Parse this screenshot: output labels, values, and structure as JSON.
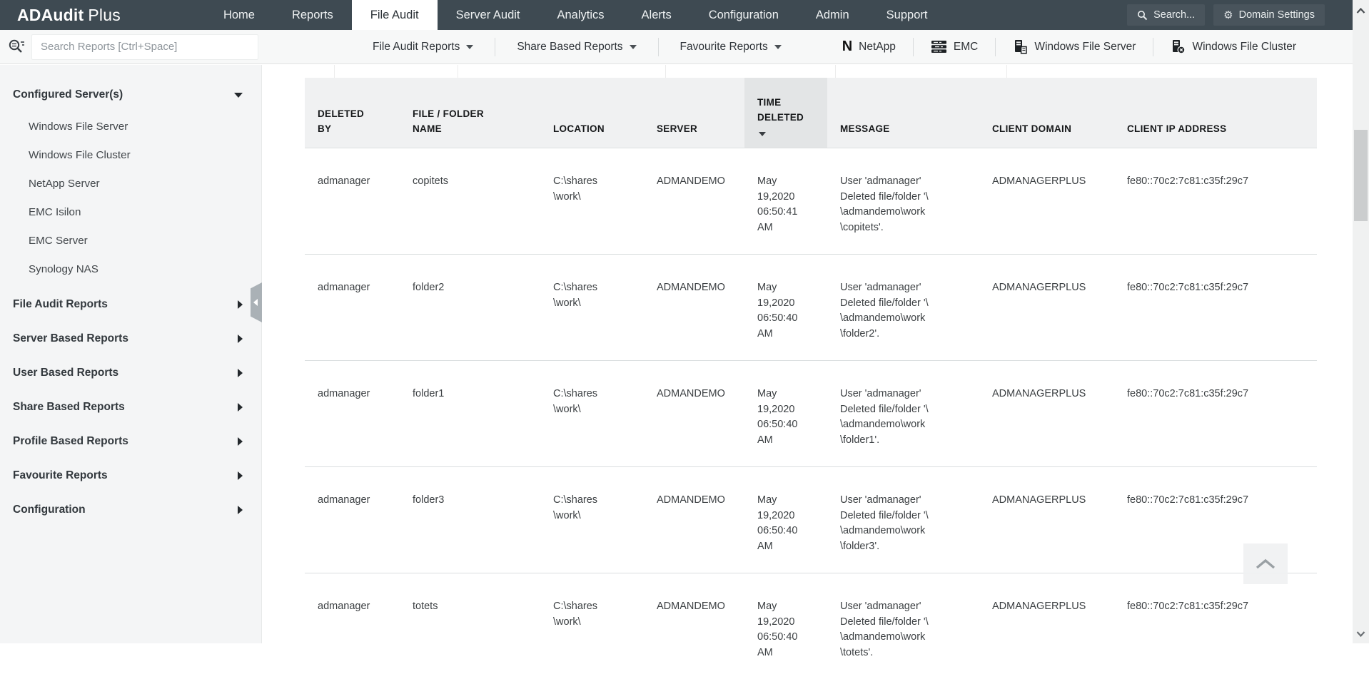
{
  "nav": {
    "brand_bold": "ADAudit",
    "brand_light": "Plus",
    "items": [
      {
        "label": "Home",
        "active": false
      },
      {
        "label": "Reports",
        "active": false
      },
      {
        "label": "File Audit",
        "active": true
      },
      {
        "label": "Server Audit",
        "active": false
      },
      {
        "label": "Analytics",
        "active": false
      },
      {
        "label": "Alerts",
        "active": false
      },
      {
        "label": "Configuration",
        "active": false
      },
      {
        "label": "Admin",
        "active": false
      },
      {
        "label": "Support",
        "active": false
      }
    ],
    "search_button_label": "Search...",
    "domain_settings_label": "Domain Settings"
  },
  "toolbar": {
    "search_placeholder": "Search Reports [Ctrl+Space]",
    "menus": [
      {
        "label": "File Audit Reports"
      },
      {
        "label": "Share Based Reports"
      },
      {
        "label": "Favourite Reports"
      }
    ],
    "server_shortcuts": [
      {
        "icon": "netapp-icon",
        "label": "NetApp"
      },
      {
        "icon": "emc-icon",
        "label": "EMC"
      },
      {
        "icon": "windows-file-server-icon",
        "label": "Windows File Server"
      },
      {
        "icon": "windows-file-cluster-icon",
        "label": "Windows File Cluster"
      }
    ]
  },
  "sidebar": {
    "sections": [
      {
        "label": "Configured Server(s)",
        "state": "expanded",
        "children": [
          "Windows File Server",
          "Windows File Cluster",
          "NetApp Server",
          "EMC Isilon",
          "EMC Server",
          "Synology NAS"
        ]
      },
      {
        "label": "File Audit Reports",
        "state": "collapsed",
        "children": []
      },
      {
        "label": "Server Based Reports",
        "state": "collapsed",
        "children": []
      },
      {
        "label": "User Based Reports",
        "state": "collapsed",
        "children": []
      },
      {
        "label": "Share Based Reports",
        "state": "collapsed",
        "children": []
      },
      {
        "label": "Profile Based Reports",
        "state": "collapsed",
        "children": []
      },
      {
        "label": "Favourite Reports",
        "state": "collapsed",
        "children": []
      },
      {
        "label": "Configuration",
        "state": "collapsed",
        "children": []
      }
    ]
  },
  "table": {
    "columns": [
      {
        "key": "deleted_by",
        "label": "DELETED\nBY",
        "sorted": false
      },
      {
        "key": "file_folder_name",
        "label": "FILE / FOLDER\nNAME",
        "sorted": false
      },
      {
        "key": "location",
        "label": "LOCATION",
        "sorted": false
      },
      {
        "key": "server",
        "label": "SERVER",
        "sorted": false
      },
      {
        "key": "time_deleted",
        "label": "TIME\nDELETED",
        "sorted": true,
        "sort_direction": "desc"
      },
      {
        "key": "message",
        "label": "MESSAGE",
        "sorted": false
      },
      {
        "key": "client_domain",
        "label": "CLIENT DOMAIN",
        "sorted": false
      },
      {
        "key": "client_ip_address",
        "label": "CLIENT IP ADDRESS",
        "sorted": false
      }
    ],
    "rows": [
      {
        "deleted_by": "admanager",
        "file_folder_name": "copitets",
        "location": "C:\\shares\\work\\",
        "server": "ADMANDEMO",
        "time_deleted": "May 19,2020 06:50:41 AM",
        "message": "User 'admanager' Deleted file/folder '\\\\admandemo\\work\\copitets'.",
        "client_domain": "ADMANAGERPLUS",
        "client_ip_address": "fe80::70c2:7c81:c35f:29c7"
      },
      {
        "deleted_by": "admanager",
        "file_folder_name": "folder2",
        "location": "C:\\shares\\work\\",
        "server": "ADMANDEMO",
        "time_deleted": "May 19,2020 06:50:40 AM",
        "message": "User 'admanager' Deleted file/folder '\\\\admandemo\\work\\folder2'.",
        "client_domain": "ADMANAGERPLUS",
        "client_ip_address": "fe80::70c2:7c81:c35f:29c7"
      },
      {
        "deleted_by": "admanager",
        "file_folder_name": "folder1",
        "location": "C:\\shares\\work\\",
        "server": "ADMANDEMO",
        "time_deleted": "May 19,2020 06:50:40 AM",
        "message": "User 'admanager' Deleted file/folder '\\\\admandemo\\work\\folder1'.",
        "client_domain": "ADMANAGERPLUS",
        "client_ip_address": "fe80::70c2:7c81:c35f:29c7"
      },
      {
        "deleted_by": "admanager",
        "file_folder_name": "folder3",
        "location": "C:\\shares\\work\\",
        "server": "ADMANDEMO",
        "time_deleted": "May 19,2020 06:50:40 AM",
        "message": "User 'admanager' Deleted file/folder '\\\\admandemo\\work\\folder3'.",
        "client_domain": "ADMANAGERPLUS",
        "client_ip_address": "fe80::70c2:7c81:c35f:29c7"
      },
      {
        "deleted_by": "admanager",
        "file_folder_name": "totets",
        "location": "C:\\shares\\work\\",
        "server": "ADMANDEMO",
        "time_deleted": "May 19,2020 06:50:40 AM",
        "message": "User 'admanager' Deleted file/folder '\\\\admandemo\\work\\totets'.",
        "client_domain": "ADMANAGERPLUS",
        "client_ip_address": "fe80::70c2:7c81:c35f:29c7"
      }
    ]
  },
  "colors": {
    "navbar_bg": "#3e4a52",
    "nav_button_bg": "#49545c",
    "active_tab_bg": "#ffffff",
    "toolbar_bg": "#f7f8f8",
    "sidebar_bg": "#f4f5f6",
    "table_header_bg": "#f0f1f2",
    "table_header_sorted_bg": "#e3e5e6",
    "row_divider": "#dadedf",
    "body_text": "#3c4043"
  }
}
